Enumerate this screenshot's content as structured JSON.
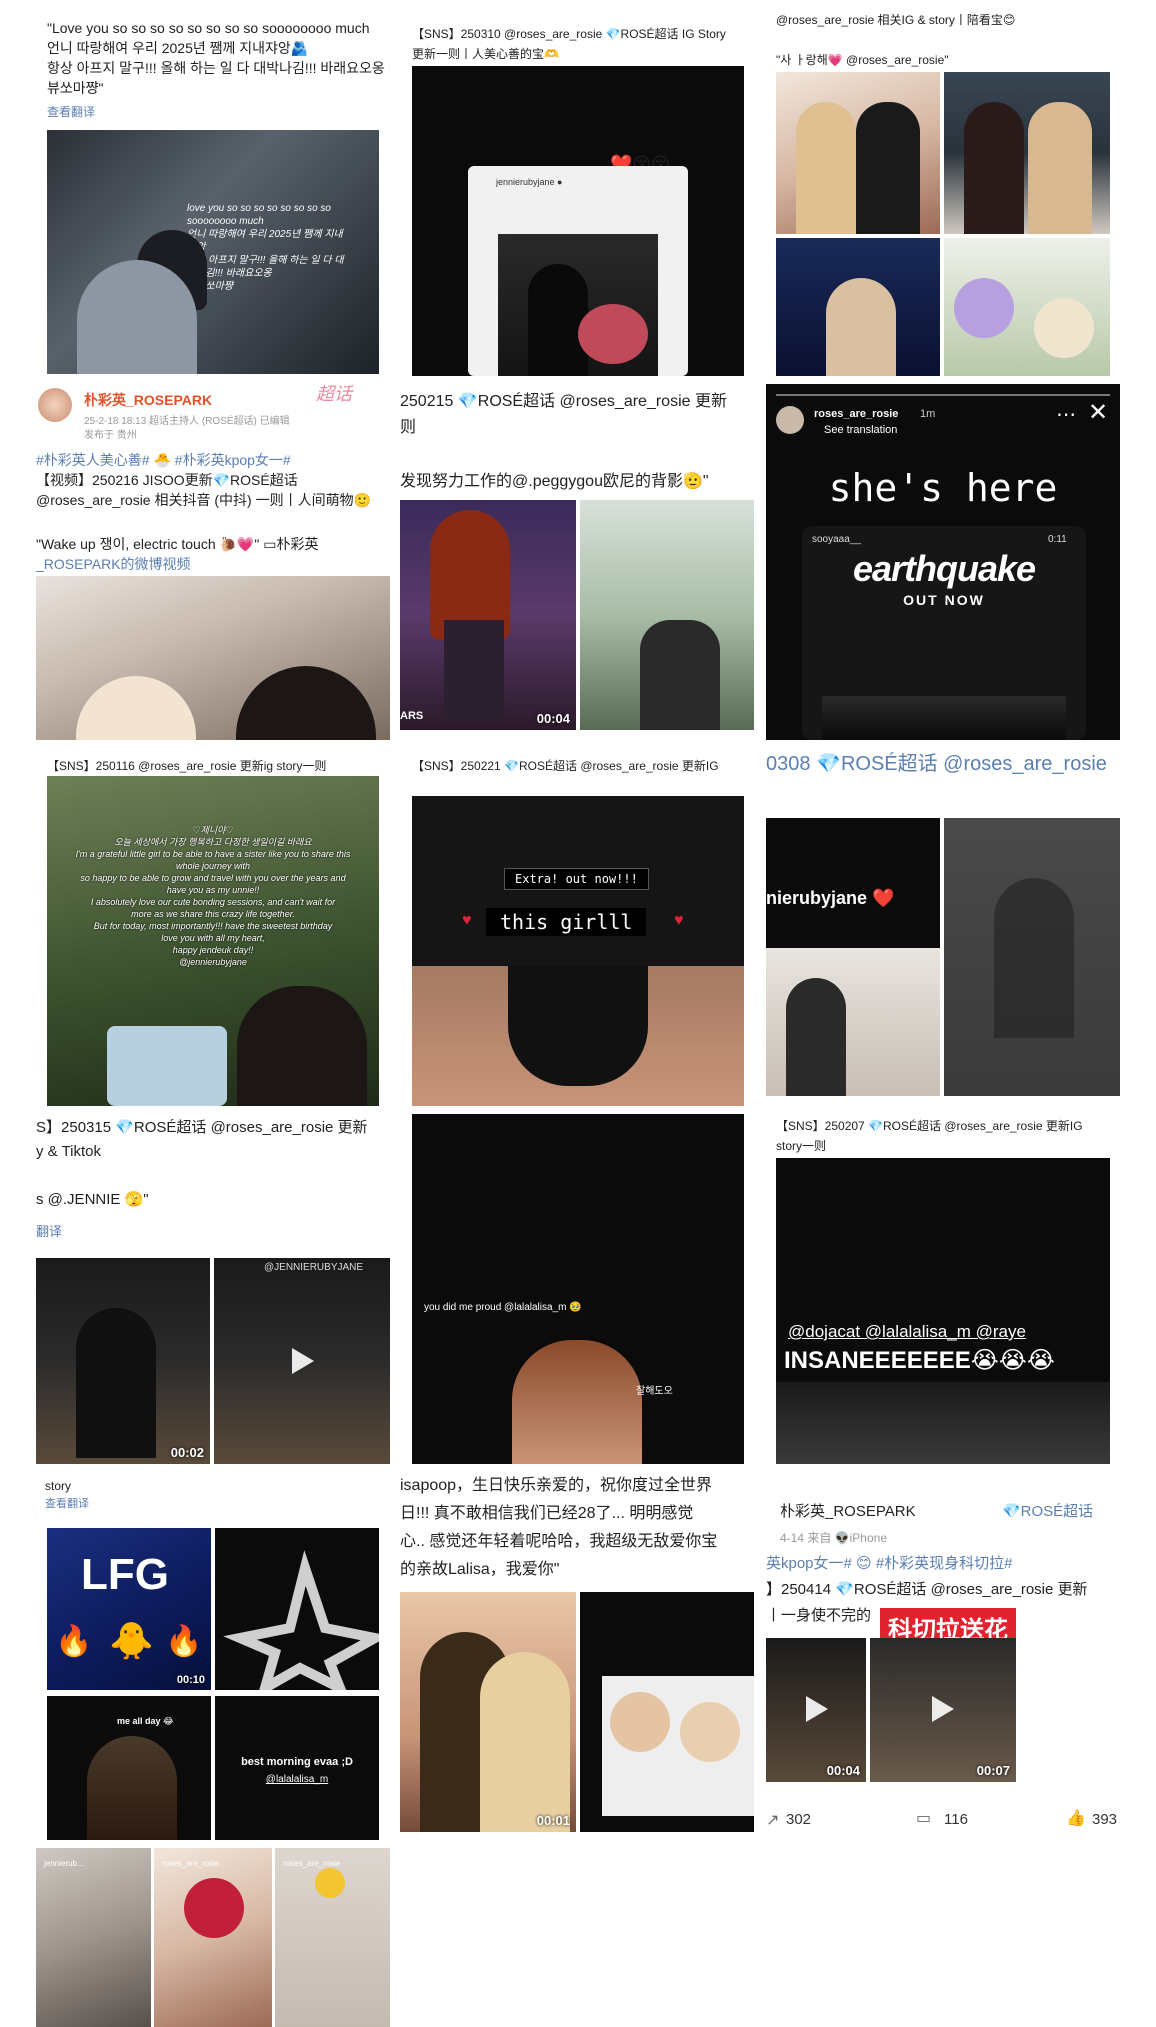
{
  "col1": {
    "post1": {
      "text_line1": "\"Love you so so so so so so so so soooooooo much",
      "text_line2": "언니 따랑해여 우리 2025년 쨈께 지내쟈앙🫂",
      "text_line3": "항상 아프지 말구!!! 올해 하는 일 다 대박나김!!! 바래요오옹 라",
      "text_line4": "뷰쏘마쨩\"",
      "translate": "查看翻译",
      "img_caption1": "love you so so so so so so so so",
      "img_caption2": "soooooooo much",
      "img_caption3": "언니 따랑해여 우리 2025년 쨈께 지내",
      "img_caption4": "쟈앙",
      "img_caption5": "항상 아프지 말구!!! 올해 하는 일 다 대",
      "img_caption6": "박나김!!! 바래요오옹",
      "img_caption7": "라뷰쏘마쨩"
    },
    "post2": {
      "username": "朴彩英_ROSEPARK",
      "supertopic_tag": "超话",
      "meta_line": "25-2-18 18:13  超话主持人 (ROSÉ超话)  已编辑",
      "location": "发布于 贵州",
      "hashtags": "#朴彩英人美心善# 🐣 #朴彩英kpop女一#",
      "line1": "【视频】250216 JISOO更新💎ROSÉ超话",
      "line2": "@roses_are_rosie 相关抖音 (中抖) 一则丨人间萌物🙂",
      "quote1": "\"Wake up 쟁이, electric touch 🐌💗\" ▭朴彩英",
      "quote2": "_ROSEPARK的微博视频"
    },
    "post3": {
      "title": "【SNS】250116 @roses_are_rosie 更新ig story一则",
      "letter": [
        "♡제니야♡",
        "오늘 세상에서 가장 행복하고 다정한 생일이길 바래요",
        "I'm a grateful little girl to be able to have a sister like you to share this",
        "whole journey with",
        "so happy to be able to grow and travel with you over the years and",
        "have you as my unnie!!",
        "I absolutely love our cute bonding sessions, and can't wait for",
        "more as we share this crazy life together.",
        "But for today, most importantly!!! have the sweetest birthday",
        "love you with all my heart,",
        "happy jendeuk day!!",
        "@jennierubyjane"
      ]
    },
    "post4": {
      "title": "S】250315 💎ROSÉ超话  @roses_are_rosie 更新",
      "subtitle": "y & Tiktok",
      "quote": "s @.JENNIE 🫣\"",
      "translate": "翻译",
      "duration": "00:02",
      "img_label": "@JENNIERUBYJANE"
    },
    "post5": {
      "title": "story",
      "translate": "查看翻译",
      "lfg": "LFG",
      "duration": "00:10",
      "me_all_day": "me all day 😂",
      "best_morning": "best morning evaa ;D",
      "handle": "@lalalalisa_m"
    },
    "post6": {
      "tabs": [
        "jennierub...",
        "roses_are_rosie",
        "roses_are_rosie"
      ]
    }
  },
  "col2": {
    "post1": {
      "title": "【SNS】250310 @roses_are_rosie 💎ROSÉ超话  IG Story",
      "subtitle": "更新一则丨人美心善的宝🫶",
      "hearts": "❤️😚😚",
      "polaroid_user": "jennierubyjane ●"
    },
    "post2": {
      "title": "250215 💎ROSÉ超话  @roses_are_rosie 更新",
      "subtitle": "则",
      "quote": "发现努力工作的@.peggygou欧尼的背影🫡\"",
      "duration": "00:04",
      "img_text": "ARS"
    },
    "post3": {
      "title": "【SNS】250221 💎ROSÉ超话  @roses_are_rosie 更新IG",
      "banner1": "Extra! out now!!!",
      "banner2": "this girlll"
    },
    "post4": {
      "caption": "you did me proud @lalalalisa_m 🥹",
      "sub": "잘해도오"
    },
    "post5": {
      "line1": "isapoop，生日快乐亲爱的，祝你度过全世界",
      "line2": "日!!! 真不敢相信我们已经28了... 明明感觉",
      "line3": "心.. 感觉还年轻着呢哈哈，我超级无敌爱你宝",
      "line4": "的亲故Lalisa，我爱你\"",
      "duration": "00:01"
    }
  },
  "col3": {
    "post1": {
      "top_line": "@roses_are_rosie 相关IG & story丨陪看宝😊",
      "quote": "\"사 ㅏ랑해💗 @roses_are_rosie\""
    },
    "post2": {
      "username": "roses_are_rosie",
      "time": "1m",
      "see_translation": "See translation",
      "headline": "she's here",
      "inner_user": "sooyaaa__",
      "inner_time": "0:11",
      "logo": "earthquake",
      "out_now": "OUT NOW"
    },
    "post3": {
      "title": "0308 💎ROSÉ超话  @roses_are_rosie",
      "tag": "nierubyjane ❤️"
    },
    "post4": {
      "title": "【SNS】250207 💎ROSÉ超话  @roses_are_rosie 更新IG",
      "subtitle": "story一则",
      "mentions": "@dojacat @lalalalisa_m @raye",
      "insane": "INSANEEEEEEE😭😭😭"
    },
    "post5": {
      "username": "朴彩英_ROSEPARK",
      "tag": "💎ROSÉ超话",
      "meta": "4-14  来自 👽iPhone",
      "hashtags": "英kpop女一# 😊 #朴彩英现身科切拉#",
      "line1": "】250414 💎ROSÉ超话  @roses_are_rosie 更新",
      "line2": "丨一身使不完的",
      "banner": "科切拉送花",
      "dur1": "00:04",
      "dur2": "00:07",
      "shares": "302",
      "comments": "116",
      "likes": "393"
    }
  },
  "colors": {
    "link": "#5b7fb0",
    "text": "#222222",
    "red_banner": "#e0232f"
  }
}
